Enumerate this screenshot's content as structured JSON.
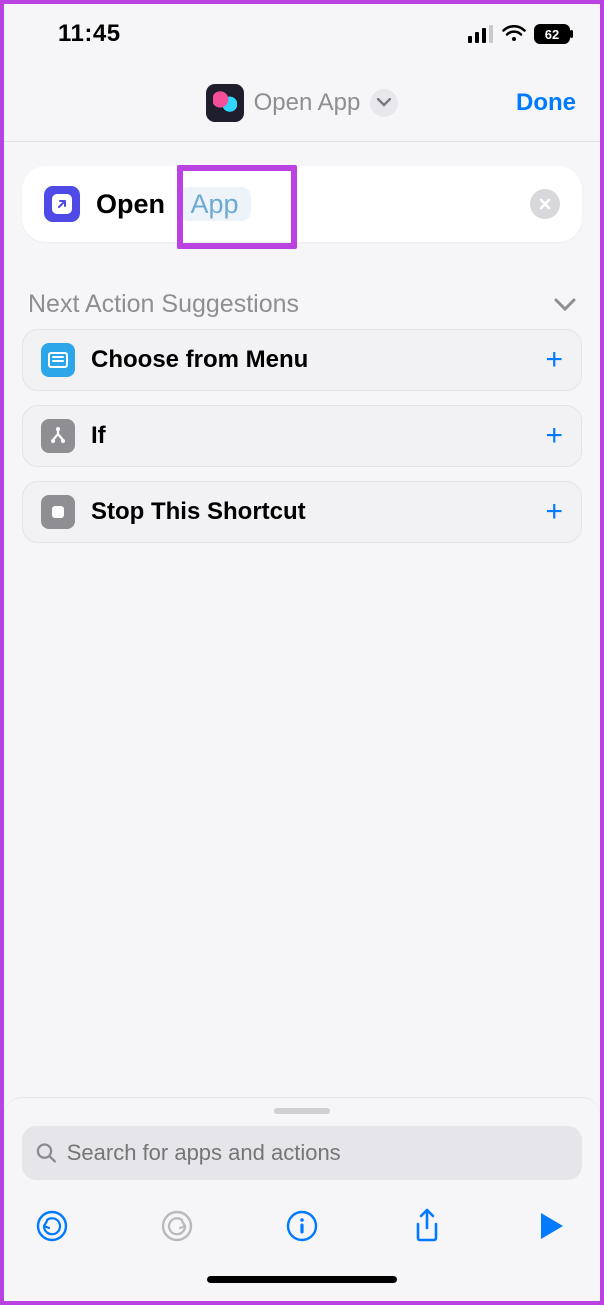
{
  "status": {
    "time": "11:45",
    "battery_pct": "62"
  },
  "header": {
    "title": "Open App",
    "done_label": "Done"
  },
  "action_card": {
    "verb": "Open",
    "parameter_token": "App"
  },
  "suggestions": {
    "header_label": "Next Action Suggestions",
    "items": [
      {
        "label": "Choose from Menu",
        "icon": "menu"
      },
      {
        "label": "If",
        "icon": "if"
      },
      {
        "label": "Stop This Shortcut",
        "icon": "stop"
      }
    ]
  },
  "search": {
    "placeholder": "Search for apps and actions"
  },
  "colors": {
    "accent": "#007aff",
    "annotation": "#b942e0"
  }
}
